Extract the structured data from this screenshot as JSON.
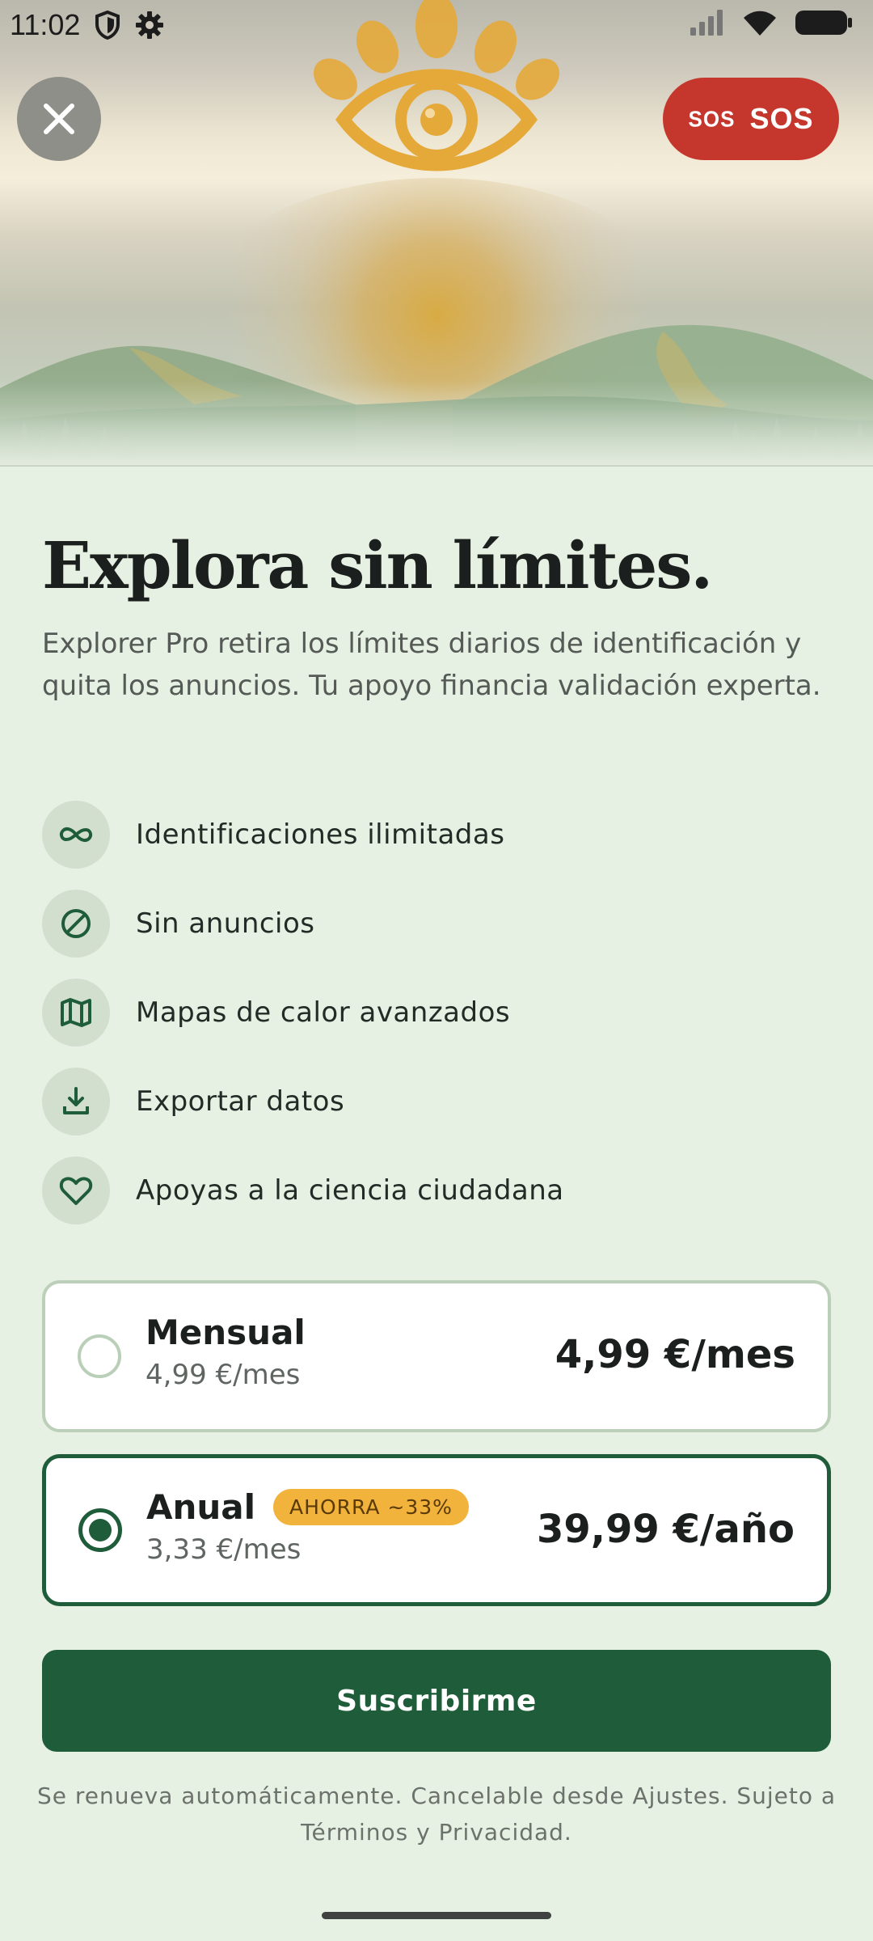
{
  "status_bar": {
    "time": "11:02",
    "icons": [
      "shield-icon",
      "gear-icon",
      "signal-icon",
      "wifi-icon",
      "battery-icon"
    ]
  },
  "hero": {
    "logo": "eye-logo",
    "close_icon": "close-icon",
    "sos_badge_text": "SOS",
    "sos_label": "SOS",
    "colors": {
      "sos": "#c5372c",
      "logo": "#e5a93a"
    }
  },
  "headline": "Explora sin límites.",
  "subtitle": "Explorer Pro retira los límites diarios de identificación y quita los anuncios. Tu apoyo financia validación experta.",
  "features": [
    {
      "icon": "infinity-icon",
      "label": "Identificaciones ilimitadas"
    },
    {
      "icon": "no-ads-icon",
      "label": "Sin anuncios"
    },
    {
      "icon": "map-icon",
      "label": "Mapas de calor avanzados"
    },
    {
      "icon": "download-icon",
      "label": "Exportar datos"
    },
    {
      "icon": "heart-icon",
      "label": "Apoyas a la ciencia ciudadana"
    }
  ],
  "plans": {
    "monthly": {
      "name": "Mensual",
      "sub": "4,99 €/mes",
      "price": "4,99 €/mes",
      "selected": false
    },
    "annual": {
      "name": "Anual",
      "badge": "AHORRA ~33%",
      "sub": "3,33 €/mes",
      "price": "39,99 €/año",
      "selected": true
    }
  },
  "cta_label": "Suscribirme",
  "legal": "Se renueva automáticamente. Cancelable desde Ajustes. Sujeto a Términos y Privacidad.",
  "colors": {
    "primary": "#1f5c3a",
    "background": "#e6f0e3",
    "badge": "#f2b33d"
  }
}
